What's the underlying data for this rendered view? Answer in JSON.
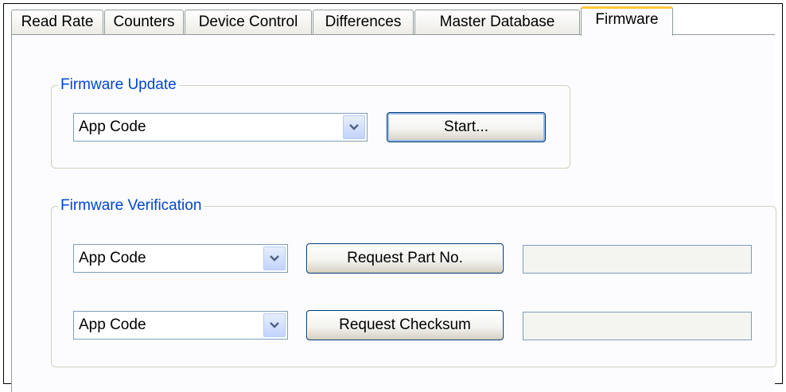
{
  "tabs": [
    {
      "label": "Read Rate"
    },
    {
      "label": "Counters"
    },
    {
      "label": "Device Control"
    },
    {
      "label": "Differences"
    },
    {
      "label": "Master Database"
    },
    {
      "label": "Firmware",
      "active": true
    }
  ],
  "firmware_update": {
    "title": "Firmware Update",
    "select_value": "App Code",
    "start_label": "Start..."
  },
  "firmware_verification": {
    "title": "Firmware Verification",
    "part_select_value": "App Code",
    "part_button_label": "Request Part No.",
    "part_result": "",
    "checksum_select_value": "App Code",
    "checksum_button_label": "Request Checksum",
    "checksum_result": ""
  },
  "icons": {
    "dropdown": "chevron-down-icon"
  },
  "colors": {
    "group_title": "#0046d5",
    "active_tab_accent": "#ffc83c"
  }
}
